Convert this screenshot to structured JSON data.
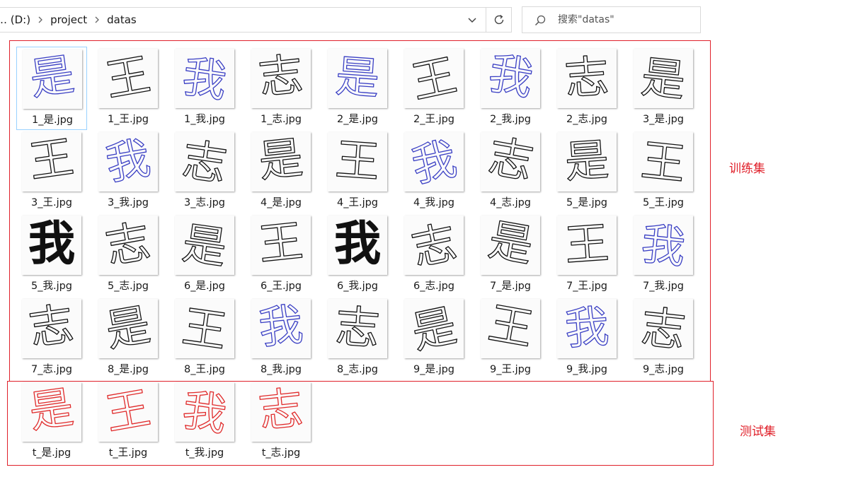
{
  "address_bar": {
    "segments": [
      "光盘 (D:)",
      "project",
      "datas"
    ],
    "visible_first_segment": "… (D:)"
  },
  "search": {
    "placeholder": "搜索\"datas\""
  },
  "annotations": {
    "train_label": "训练集",
    "test_label": "测试集",
    "color": "#e0202a"
  },
  "files": [
    {
      "name": "1_是.jpg",
      "glyph": "是",
      "ink": "#3a3fc4"
    },
    {
      "name": "1_王.jpg",
      "glyph": "王",
      "ink": "#111111"
    },
    {
      "name": "1_我.jpg",
      "glyph": "我",
      "ink": "#3a3fc4"
    },
    {
      "name": "1_志.jpg",
      "glyph": "志",
      "ink": "#111111"
    },
    {
      "name": "2_是.jpg",
      "glyph": "是",
      "ink": "#3a3fc4"
    },
    {
      "name": "2_王.jpg",
      "glyph": "王",
      "ink": "#111111"
    },
    {
      "name": "2_我.jpg",
      "glyph": "我",
      "ink": "#3a3fc4"
    },
    {
      "name": "2_志.jpg",
      "glyph": "志",
      "ink": "#111111"
    },
    {
      "name": "3_是.jpg",
      "glyph": "是",
      "ink": "#111111"
    },
    {
      "name": "3_王.jpg",
      "glyph": "王",
      "ink": "#111111"
    },
    {
      "name": "3_我.jpg",
      "glyph": "我",
      "ink": "#3a3fc4"
    },
    {
      "name": "3_志.jpg",
      "glyph": "志",
      "ink": "#111111"
    },
    {
      "name": "4_是.jpg",
      "glyph": "是",
      "ink": "#111111"
    },
    {
      "name": "4_王.jpg",
      "glyph": "王",
      "ink": "#111111"
    },
    {
      "name": "4_我.jpg",
      "glyph": "我",
      "ink": "#3a3fc4"
    },
    {
      "name": "4_志.jpg",
      "glyph": "志",
      "ink": "#111111"
    },
    {
      "name": "5_是.jpg",
      "glyph": "是",
      "ink": "#111111"
    },
    {
      "name": "5_王.jpg",
      "glyph": "王",
      "ink": "#111111"
    },
    {
      "name": "5_我.jpg",
      "glyph": "我",
      "ink": "#111111",
      "bold": true
    },
    {
      "name": "5_志.jpg",
      "glyph": "志",
      "ink": "#111111"
    },
    {
      "name": "6_是.jpg",
      "glyph": "是",
      "ink": "#111111"
    },
    {
      "name": "6_王.jpg",
      "glyph": "王",
      "ink": "#111111"
    },
    {
      "name": "6_我.jpg",
      "glyph": "我",
      "ink": "#111111",
      "bold": true
    },
    {
      "name": "6_志.jpg",
      "glyph": "志",
      "ink": "#111111"
    },
    {
      "name": "7_是.jpg",
      "glyph": "是",
      "ink": "#111111"
    },
    {
      "name": "7_王.jpg",
      "glyph": "王",
      "ink": "#111111"
    },
    {
      "name": "7_我.jpg",
      "glyph": "我",
      "ink": "#3a3fc4"
    },
    {
      "name": "7_志.jpg",
      "glyph": "志",
      "ink": "#111111"
    },
    {
      "name": "8_是.jpg",
      "glyph": "是",
      "ink": "#111111"
    },
    {
      "name": "8_王.jpg",
      "glyph": "王",
      "ink": "#111111"
    },
    {
      "name": "8_我.jpg",
      "glyph": "我",
      "ink": "#3a3fc4"
    },
    {
      "name": "8_志.jpg",
      "glyph": "志",
      "ink": "#111111"
    },
    {
      "name": "9_是.jpg",
      "glyph": "是",
      "ink": "#111111"
    },
    {
      "name": "9_王.jpg",
      "glyph": "王",
      "ink": "#111111"
    },
    {
      "name": "9_我.jpg",
      "glyph": "我",
      "ink": "#3a3fc4"
    },
    {
      "name": "9_志.jpg",
      "glyph": "志",
      "ink": "#111111"
    },
    {
      "name": "t_是.jpg",
      "glyph": "是",
      "ink": "#e02b2b"
    },
    {
      "name": "t_王.jpg",
      "glyph": "王",
      "ink": "#e02b2b"
    },
    {
      "name": "t_我.jpg",
      "glyph": "我",
      "ink": "#e02b2b"
    },
    {
      "name": "t_志.jpg",
      "glyph": "志",
      "ink": "#e02b2b"
    }
  ],
  "selected_index": 0
}
